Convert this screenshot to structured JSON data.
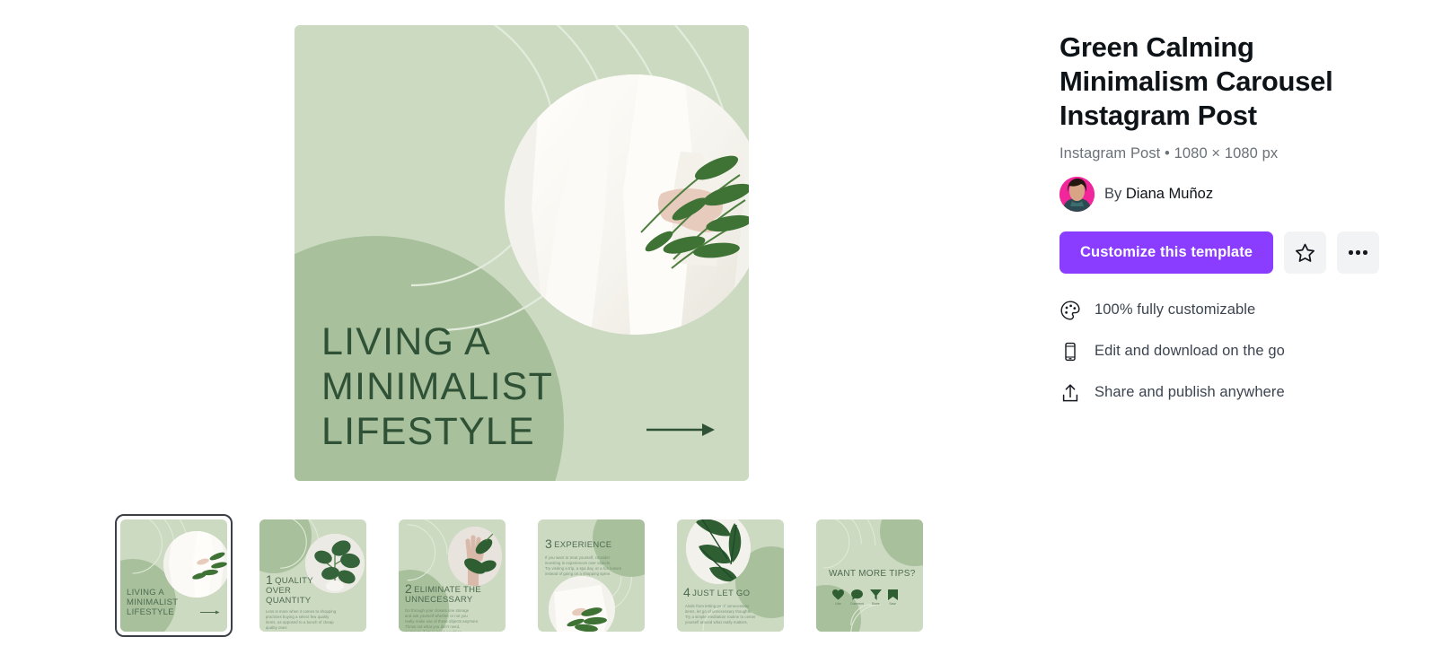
{
  "template": {
    "title": "Green Calming Minimalism Carousel Instagram Post",
    "meta": "Instagram Post • 1080 × 1080 px",
    "author_prefix": "By",
    "author_name": "Diana Muñoz",
    "accent_color": "#8b3dff"
  },
  "actions": {
    "primary_label": "Customize this template",
    "favorite_icon": "star-icon",
    "more_icon": "ellipsis-icon"
  },
  "features": [
    {
      "icon": "palette-icon",
      "label": "100% fully customizable"
    },
    {
      "icon": "mobile-icon",
      "label": "Edit and download on the go"
    },
    {
      "icon": "share-icon",
      "label": "Share and publish anywhere"
    }
  ],
  "preview": {
    "headline": "LIVING A\nMINIMALIST\nLIFESTYLE",
    "arrow_icon": "arrow-right-icon",
    "bg_color": "#ccdac2",
    "blob_color": "#a8c09c",
    "text_color": "#2f5236"
  },
  "thumbnails": [
    {
      "selected": true,
      "kind": "cover",
      "headline": "LIVING A\nMINIMALIST\nLIFESTYLE",
      "number": "",
      "body": "",
      "arrow": true
    },
    {
      "selected": false,
      "kind": "tip",
      "number": "1",
      "headline": "QUALITY\nOVER\nQUANTITY",
      "body": "Less is more when it comes to shopping\npractices buying a select few quality\nitems, as opposed to a bunch of cheap\nquality ones",
      "arrow": false
    },
    {
      "selected": false,
      "kind": "tip",
      "number": "2",
      "headline": "ELIMINATE THE\nUNNECESSARY",
      "body": "Go through your closets one storage\nand ask yourself whether or not you\nreally make use of these objects anymore.\nThrow out what you don't need,\nor donate if it's in good condition.",
      "arrow": false
    },
    {
      "selected": false,
      "kind": "tip-top",
      "number": "3",
      "headline": "EXPERIENCE",
      "body": "If you want to treat yourself, consider\ninvesting in experiences over objects.\nTry visiting a trip, a spa day, or a fun leisure\ninstead of going on a shopping spree.",
      "arrow": false
    },
    {
      "selected": false,
      "kind": "tip",
      "number": "4",
      "headline": "JUST LET GO",
      "body": "Aside from letting go of unnecessary\nitems, let go of unnecessary thoughts.\nTry a simple meditation routine to center\nyourself around what really matters.",
      "arrow": false
    },
    {
      "selected": false,
      "kind": "outro",
      "number": "",
      "headline": "WANT MORE TIPS?",
      "body": "",
      "arrow": false,
      "socials": [
        {
          "icon": "heart-icon",
          "label": "Like"
        },
        {
          "icon": "comment-icon",
          "label": "Comment"
        },
        {
          "icon": "share-icon",
          "label": "Share"
        },
        {
          "icon": "bookmark-icon",
          "label": "Save"
        }
      ]
    }
  ]
}
